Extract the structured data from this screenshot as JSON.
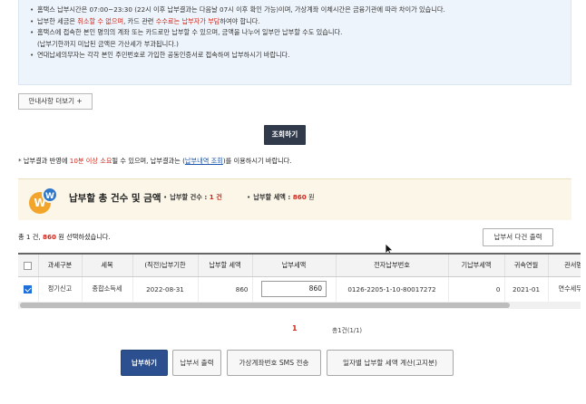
{
  "notice": {
    "line1": "홈택스 납부시간은 07:00~23:30 (22시 이후 납부결과는 다음날 07시 이후 확인 가능)이며, 가상계좌 이체시간은 금융기관에 따라 차이가 있습니다.",
    "line2_a": "납부한 세금은 ",
    "line2_b": "취소할 수 없으며",
    "line2_c": ", 카드 관련 ",
    "line2_d": "수수료는 납부자가 부담",
    "line2_e": "하여야 합니다.",
    "line3": "홈택스에 접속한 본인 명의의 계좌 또는 카드로만 납부할 수 있으며, 금액을 나누어 일부만 납부할 수도 있습니다.",
    "line3_sub": "(납부기한까지 미납된 금액은 가산세가 부과됩니다.)",
    "line4": "연대납세의무자는 각각 본인 주민번호로 가입한 공동인증서로 접속하여 납부하시기 바랍니다."
  },
  "more_button": "안내사항 더보기 +",
  "search_button": "조회하기",
  "result_note": {
    "a": "* 납부결과 반영에 ",
    "b": "10분 이상 소요",
    "c": "될 수 있으며, 납부결과는 (",
    "d": "납부내역 조회",
    "e": ")를 이용하시기 바랍니다."
  },
  "summary": {
    "title": "납부할 총 건수 및 금액",
    "count_label": "납부할 건수 : ",
    "count_value": "1 건",
    "amount_label": "납부할 세액 : ",
    "amount_value": "860",
    "amount_unit": " 원"
  },
  "selected": {
    "a": "총 1 건, ",
    "b": "860",
    "c": " 원 선택하셨습니다."
  },
  "print_all_button": "납부서 다건 출력",
  "table": {
    "headers": [
      "",
      "과세구분",
      "세목",
      "(직전)납부기한",
      "납부할 세액",
      "납부세액",
      "전자납부번호",
      "기납부세액",
      "귀속연월",
      "관서명"
    ],
    "row": {
      "type": "정기신고",
      "tax": "종합소득세",
      "due": "2022-08-31",
      "payable": "860",
      "amount": "860",
      "epay": "0126-2205-1-10-80017272",
      "paid": "0",
      "period": "2021-01",
      "office": "연수세무서"
    }
  },
  "pagination": {
    "current": "1",
    "info": "총1건(1/1)"
  },
  "actions": {
    "pay": "납부하기",
    "print": "납부서 출력",
    "sms": "가상계좌번호 SMS 전송",
    "calc": "일자별 납부할 세액 계산(고지분)"
  },
  "colors": {
    "accent_red": "#d0281c",
    "primary_blue": "#2b4f8f",
    "notice_bg": "#eef4fb",
    "summary_bg": "#fbf6e8"
  }
}
